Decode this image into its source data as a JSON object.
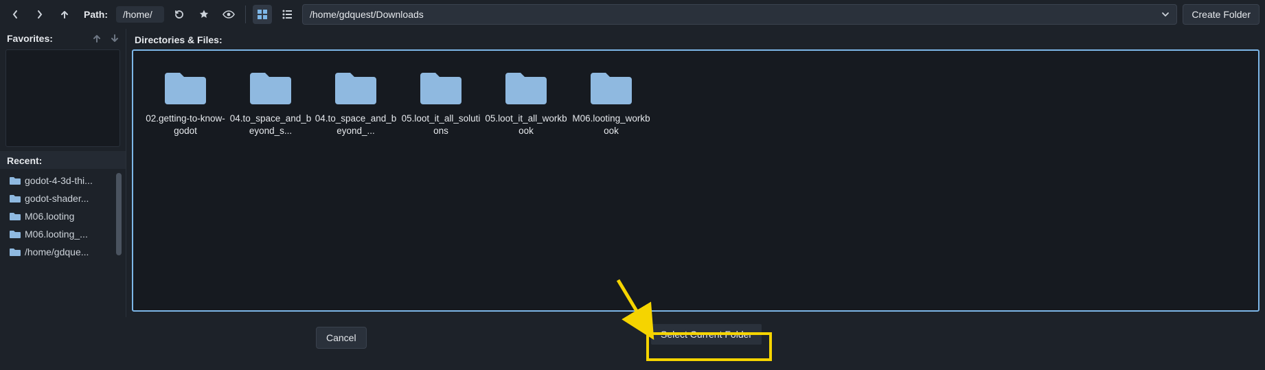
{
  "toolbar": {
    "path_label": "Path:",
    "path_segment": "/home/",
    "path_value": "/home/gdquest/Downloads",
    "create_folder": "Create Folder"
  },
  "sidebar": {
    "favorites_label": "Favorites:",
    "recent_label": "Recent:",
    "recent_items": [
      "godot-4-3d-thi...",
      "godot-shader...",
      "M06.looting",
      "M06.looting_...",
      "/home/gdque..."
    ]
  },
  "content": {
    "header": "Directories & Files:",
    "folders": [
      {
        "label": "02.getting-to-know-godot"
      },
      {
        "label": "04.to_space_and_beyond_s..."
      },
      {
        "label": "04.to_space_and_beyond_..."
      },
      {
        "label": "05.loot_it_all_solutions"
      },
      {
        "label": "05.loot_it_all_workbook"
      },
      {
        "label": "M06.looting_workbook"
      }
    ]
  },
  "footer": {
    "cancel": "Cancel",
    "select": "Select Current Folder"
  }
}
